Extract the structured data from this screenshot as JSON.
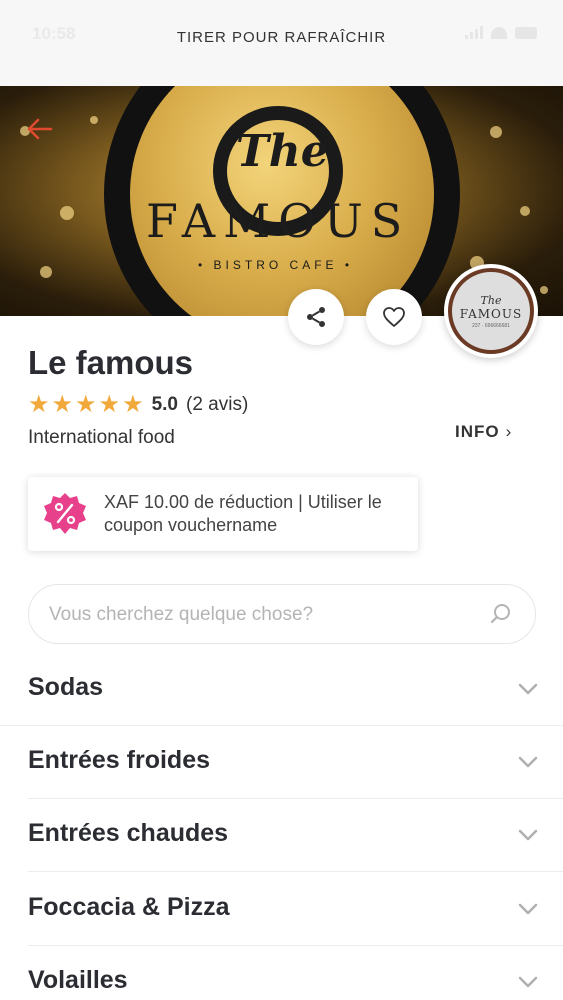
{
  "status_bar": {
    "time": "10:58",
    "pull_to_refresh": "TIRER POUR RAFRAÎCHIR"
  },
  "banner": {
    "logo_the": "The",
    "logo_famous": "FAMOUS",
    "logo_subtitle": "• BISTRO CAFE •"
  },
  "avatar": {
    "the": "The",
    "famous": "FAMOUS",
    "tel": "237 · 696666681"
  },
  "restaurant": {
    "name": "Le famous",
    "rating": "5.0",
    "reviews": "(2 avis)",
    "stars": 5,
    "cuisine": "International food",
    "info_label": "INFO"
  },
  "coupon": {
    "text": "XAF 10.00 de réduction | Utiliser le coupon vouchername",
    "icon": "percent-badge-icon",
    "accent_color": "#e8418c"
  },
  "search": {
    "placeholder": "Vous cherchez quelque chose?"
  },
  "categories": [
    {
      "label": "Sodas"
    },
    {
      "label": "Entrées froides"
    },
    {
      "label": "Entrées chaudes"
    },
    {
      "label": "Foccacia & Pizza"
    },
    {
      "label": "Volailles"
    }
  ],
  "colors": {
    "back_arrow": "#e04a2f",
    "star": "#f2a93b"
  }
}
